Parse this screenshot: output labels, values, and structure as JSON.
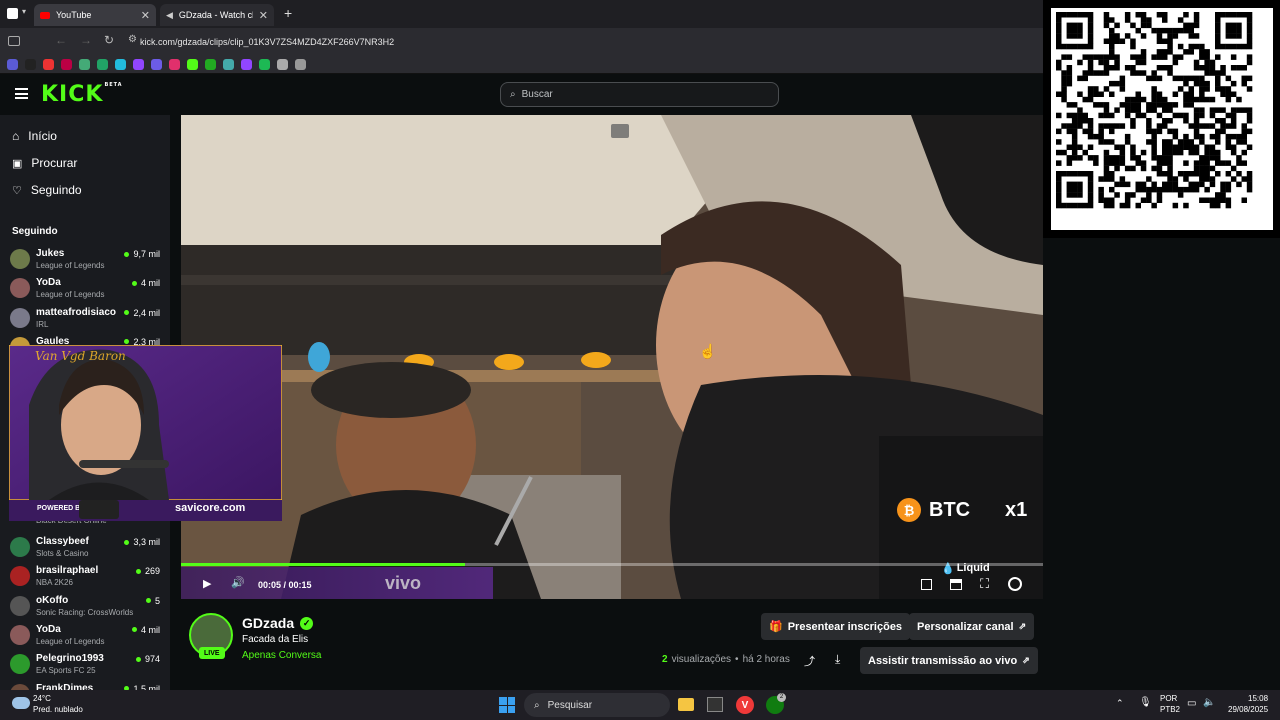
{
  "browser": {
    "tabs": [
      {
        "label": "YouTube",
        "active": false
      },
      {
        "label": "GDzada - Watch clips o",
        "active": true
      }
    ],
    "url": "kick.com/gdzada/clips/clip_01K3V7ZS4MZD4ZXF266V7NR3H2",
    "bookmark_colors": [
      "#5b5bd6",
      "#222",
      "#e33",
      "#b04",
      "#4a7",
      "#21a366",
      "#2bd",
      "#9146ff",
      "#6c5ce7",
      "#e1306c",
      "#53fc18",
      "#2a2",
      "#4aa",
      "#9146ff",
      "#1db954",
      "#aaa",
      "#999"
    ]
  },
  "header": {
    "logo": "KICK",
    "logo_badge": "BETA",
    "search_placeholder": "Buscar"
  },
  "sidebar": {
    "nav": [
      {
        "label": "Início",
        "icon": "home-icon"
      },
      {
        "label": "Procurar",
        "icon": "browse-icon"
      },
      {
        "label": "Seguindo",
        "icon": "heart-icon"
      }
    ],
    "following_title": "Seguindo",
    "channels_top": [
      {
        "name": "Jukes",
        "game": "League of Legends",
        "viewers": "9,7 mil",
        "color": "#6d7a4a"
      },
      {
        "name": "YoDa",
        "game": "League of Legends",
        "viewers": "4 mil",
        "color": "#8a5a5a"
      },
      {
        "name": "matteafrodisiaco",
        "game": "IRL",
        "viewers": "2,4 mil",
        "color": "#7a7a8a"
      },
      {
        "name": "Gaules",
        "game": "",
        "viewers": "2,3 mil",
        "color": "#c49a3a"
      }
    ],
    "channels_bottom": [
      {
        "name": "Classybeef",
        "game": "Slots & Casino",
        "viewers": "3,3 mil",
        "color": "#2c7a4a"
      },
      {
        "name": "brasilraphael",
        "game": "NBA 2K26",
        "viewers": "269",
        "color": "#aa2222"
      },
      {
        "name": "oKoffo",
        "game": "Sonic Racing: CrossWorlds",
        "viewers": "5",
        "color": "#555"
      },
      {
        "name": "YoDa",
        "game": "League of Legends",
        "viewers": "4 mil",
        "color": "#8a5a5a"
      },
      {
        "name": "Pelegrino1993",
        "game": "EA Sports FC 25",
        "viewers": "974",
        "color": "#2c9a2c"
      },
      {
        "name": "FrankDimes",
        "game": "",
        "viewers": "1,5 mil",
        "color": "#6a4a3a"
      }
    ],
    "partial_game": "Black Desert Online"
  },
  "webcam": {
    "powered_by": "POWERED BY",
    "brand": "savicore.com",
    "signature": "Van Vgd Baron"
  },
  "video": {
    "btc_label": "BTC",
    "btc_mult": "x1",
    "sponsor": "Liquid",
    "time": "00:05 / 00:15",
    "watermark": "vivo",
    "progress": 0.33
  },
  "channel": {
    "name": "GDzada",
    "title": "Facada da Elis",
    "category": "Apenas Conversa",
    "live_badge": "LIVE",
    "views_count": "2",
    "views_label": "visualizações",
    "time_ago": "há 2 horas",
    "gift_button": "Presentear inscrições",
    "customize_button": "Personalizar canal",
    "watch_live_button": "Assistir transmissão ao vivo"
  },
  "taskbar": {
    "weather_temp": "24°C",
    "weather_desc": "Pred. nublado",
    "search_placeholder": "Pesquisar",
    "lang_top": "POR",
    "lang_bottom": "PTB2",
    "clock_time": "15:08",
    "clock_date": "29/08/2025",
    "xbox_badge": "2"
  }
}
